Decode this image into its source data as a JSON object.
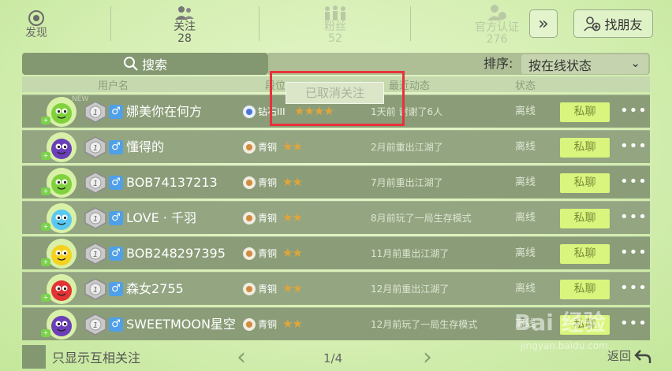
{
  "top": {
    "discover": "发现",
    "follow_label": "关注",
    "follow_count": "28",
    "fans_label": "粉丝",
    "fans_count": "52",
    "official_label": "官方认证",
    "official_count": "276",
    "more": "»",
    "find_friends": "找朋友"
  },
  "search": {
    "label": "搜索"
  },
  "sort": {
    "label": "排序:",
    "value": "按在线状态"
  },
  "header": {
    "username": "用户名",
    "level": "段位",
    "recent": "最近动态",
    "status": "状态"
  },
  "toast": "已取消关注",
  "rows": [
    {
      "name": "娜美你在何方",
      "tier": "钻石III",
      "stars": "★★★★",
      "recent": "1天前 谢谢了6人",
      "status": "离线",
      "chat": "私聊",
      "more": "•••",
      "new_tag": "NEW",
      "sex": "♂",
      "rank": "1",
      "avatar_color": "#7fd23c",
      "medal_type": "diamond"
    },
    {
      "name": "懂得的",
      "tier": "青铜",
      "stars": "★★",
      "recent": "2月前重出江湖了",
      "status": "离线",
      "chat": "私聊",
      "more": "•••",
      "sex": "♂",
      "rank": "1",
      "avatar_color": "#6a3fb8",
      "medal_type": "bronze"
    },
    {
      "name": "BOB74137213",
      "tier": "青铜",
      "stars": "★★",
      "recent": "7月前重出江湖了",
      "status": "离线",
      "chat": "私聊",
      "more": "•••",
      "sex": "♂",
      "rank": "1",
      "avatar_color": "#7fd23c",
      "medal_type": "bronze"
    },
    {
      "name": "LOVE · 千羽",
      "tier": "青铜",
      "stars": "★★",
      "recent": "8月前玩了一局生存模式",
      "status": "离线",
      "chat": "私聊",
      "more": "•••",
      "sex": "♂",
      "rank": "1",
      "avatar_color": "#59c8f0",
      "medal_type": "bronze"
    },
    {
      "name": "BOB248297395",
      "tier": "青铜",
      "stars": "★★",
      "recent": "11月前重出江湖了",
      "status": "离线",
      "chat": "私聊",
      "more": "•••",
      "sex": "♂",
      "rank": "1",
      "avatar_color": "#f5d21e",
      "medal_type": "bronze"
    },
    {
      "name": "森女2755",
      "tier": "青铜",
      "stars": "★★",
      "recent": "12月前重出江湖了",
      "status": "离线",
      "chat": "私聊",
      "more": "•••",
      "sex": "♂",
      "rank": "1",
      "avatar_color": "#e23434",
      "medal_type": "bronze"
    },
    {
      "name": "SWEETMOON星空",
      "tier": "青铜",
      "stars": "★★",
      "recent": "12月前玩了一局生存模式",
      "status": "离线",
      "chat": "私聊",
      "more": "•••",
      "sex": "♂",
      "rank": "1",
      "avatar_color": "#6a3fb8",
      "medal_type": "bronze"
    }
  ],
  "footer": {
    "mutual_only": "只显示互相关注",
    "page": "1/4",
    "prev": "‹",
    "next": "›",
    "back": "返回"
  },
  "watermark": {
    "main": "Bai 经验",
    "sub": "jingyan.baidu.com"
  }
}
